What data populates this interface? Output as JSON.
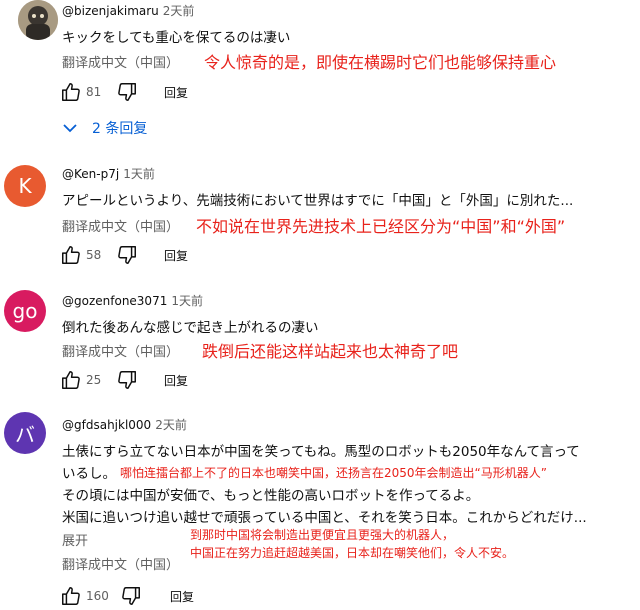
{
  "comments": [
    {
      "author": "@bizenjakimaru",
      "time": "2天前",
      "lines": [
        "キックをしても重心を保てるのは凄い"
      ],
      "translate_label": "翻译成中文（中国）",
      "annotation": "令人惊奇的是，即使在横踢时它们也能够保持重心",
      "likes": "81",
      "reply_label": "回复",
      "replies_label": "2 条回复"
    },
    {
      "author": "@Ken-p7j",
      "time": "1天前",
      "avatar_letter": "K",
      "avatar_color": "#e85a30",
      "lines": [
        "アピールというより、先端技術において世界はすでに「中国」と「外国」に別れた..."
      ],
      "translate_label": "翻译成中文（中国）",
      "annotation": "不如说在世界先进技术上已经区分为“中国”和“外国”",
      "likes": "58",
      "reply_label": "回复"
    },
    {
      "author": "@gozenfone3071",
      "time": "1天前",
      "avatar_letter": "go",
      "avatar_color": "#d81b60",
      "lines": [
        "倒れた後あんな感じで起き上がれるの凄い"
      ],
      "translate_label": "翻译成中文（中国）",
      "annotation": "跌倒后还能这样站起来也太神奇了吧",
      "likes": "25",
      "reply_label": "回复"
    },
    {
      "author": "@gfdsahjkl000",
      "time": "2天前",
      "avatar_letter": "バ",
      "avatar_color": "#5e35b1",
      "lines": [
        "土俵にすら立てない日本が中国を笑ってもね。馬型のロボットも2050年なんて言って",
        "いるし。",
        "その頃には中国が安価で、もっと性能の高いロボットを作ってるよ。",
        "米国に追いつけ追い越せで頑張っている中国と、それを笑う日本。これからどれだけ..."
      ],
      "annotation_inline": "哪怕连擂台都上不了的日本也嘲笑中国，还扬言在2050年会制造出“马形机器人”",
      "annotation_lines": [
        "到那时中国将会制造出更便宜且更强大的机器人，",
        "中国正在努力追赶超越美国，日本却在嘲笑他们，令人不安。"
      ],
      "expand_label": "展开",
      "translate_label": "翻译成中文（中国）",
      "likes": "160",
      "reply_label": "回复"
    }
  ],
  "colors": {
    "annotation": "#e8221b",
    "link": "#065fd4",
    "secondary": "#606060"
  }
}
